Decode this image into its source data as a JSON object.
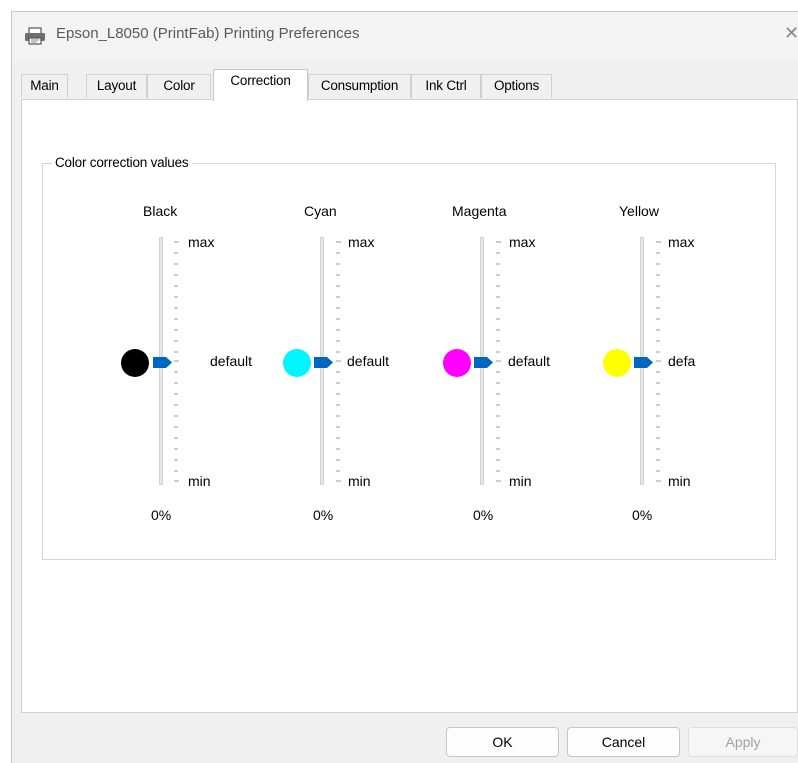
{
  "window": {
    "title": "Epson_L8050 (PrintFab) Printing Preferences"
  },
  "tabs": [
    {
      "label": "Main"
    },
    {
      "label": "Layout"
    },
    {
      "label": "Color"
    },
    {
      "label": "Correction",
      "active": true
    },
    {
      "label": "Consumption"
    },
    {
      "label": "Ink Ctrl"
    },
    {
      "label": "Options"
    }
  ],
  "group": {
    "label": "Color correction values"
  },
  "channels": [
    {
      "name": "Black",
      "color": "#000000",
      "max_label": "max",
      "default_label": "default",
      "min_label": "min",
      "value_text": "0%",
      "level": 0.5
    },
    {
      "name": "Cyan",
      "color": "#00f5ff",
      "max_label": "max",
      "default_label": "default",
      "min_label": "min",
      "value_text": "0%",
      "level": 0.5
    },
    {
      "name": "Magenta",
      "color": "#ff00ff",
      "max_label": "max",
      "default_label": "default",
      "min_label": "min",
      "value_text": "0%",
      "level": 0.5
    },
    {
      "name": "Yellow",
      "color": "#ffff00",
      "max_label": "max",
      "default_label": "defa",
      "min_label": "min",
      "value_text": "0%",
      "level": 0.5
    }
  ],
  "buttons": {
    "ok": "OK",
    "cancel": "Cancel",
    "apply": "Apply"
  },
  "colors": {
    "slider_thumb": "#0067c0"
  }
}
